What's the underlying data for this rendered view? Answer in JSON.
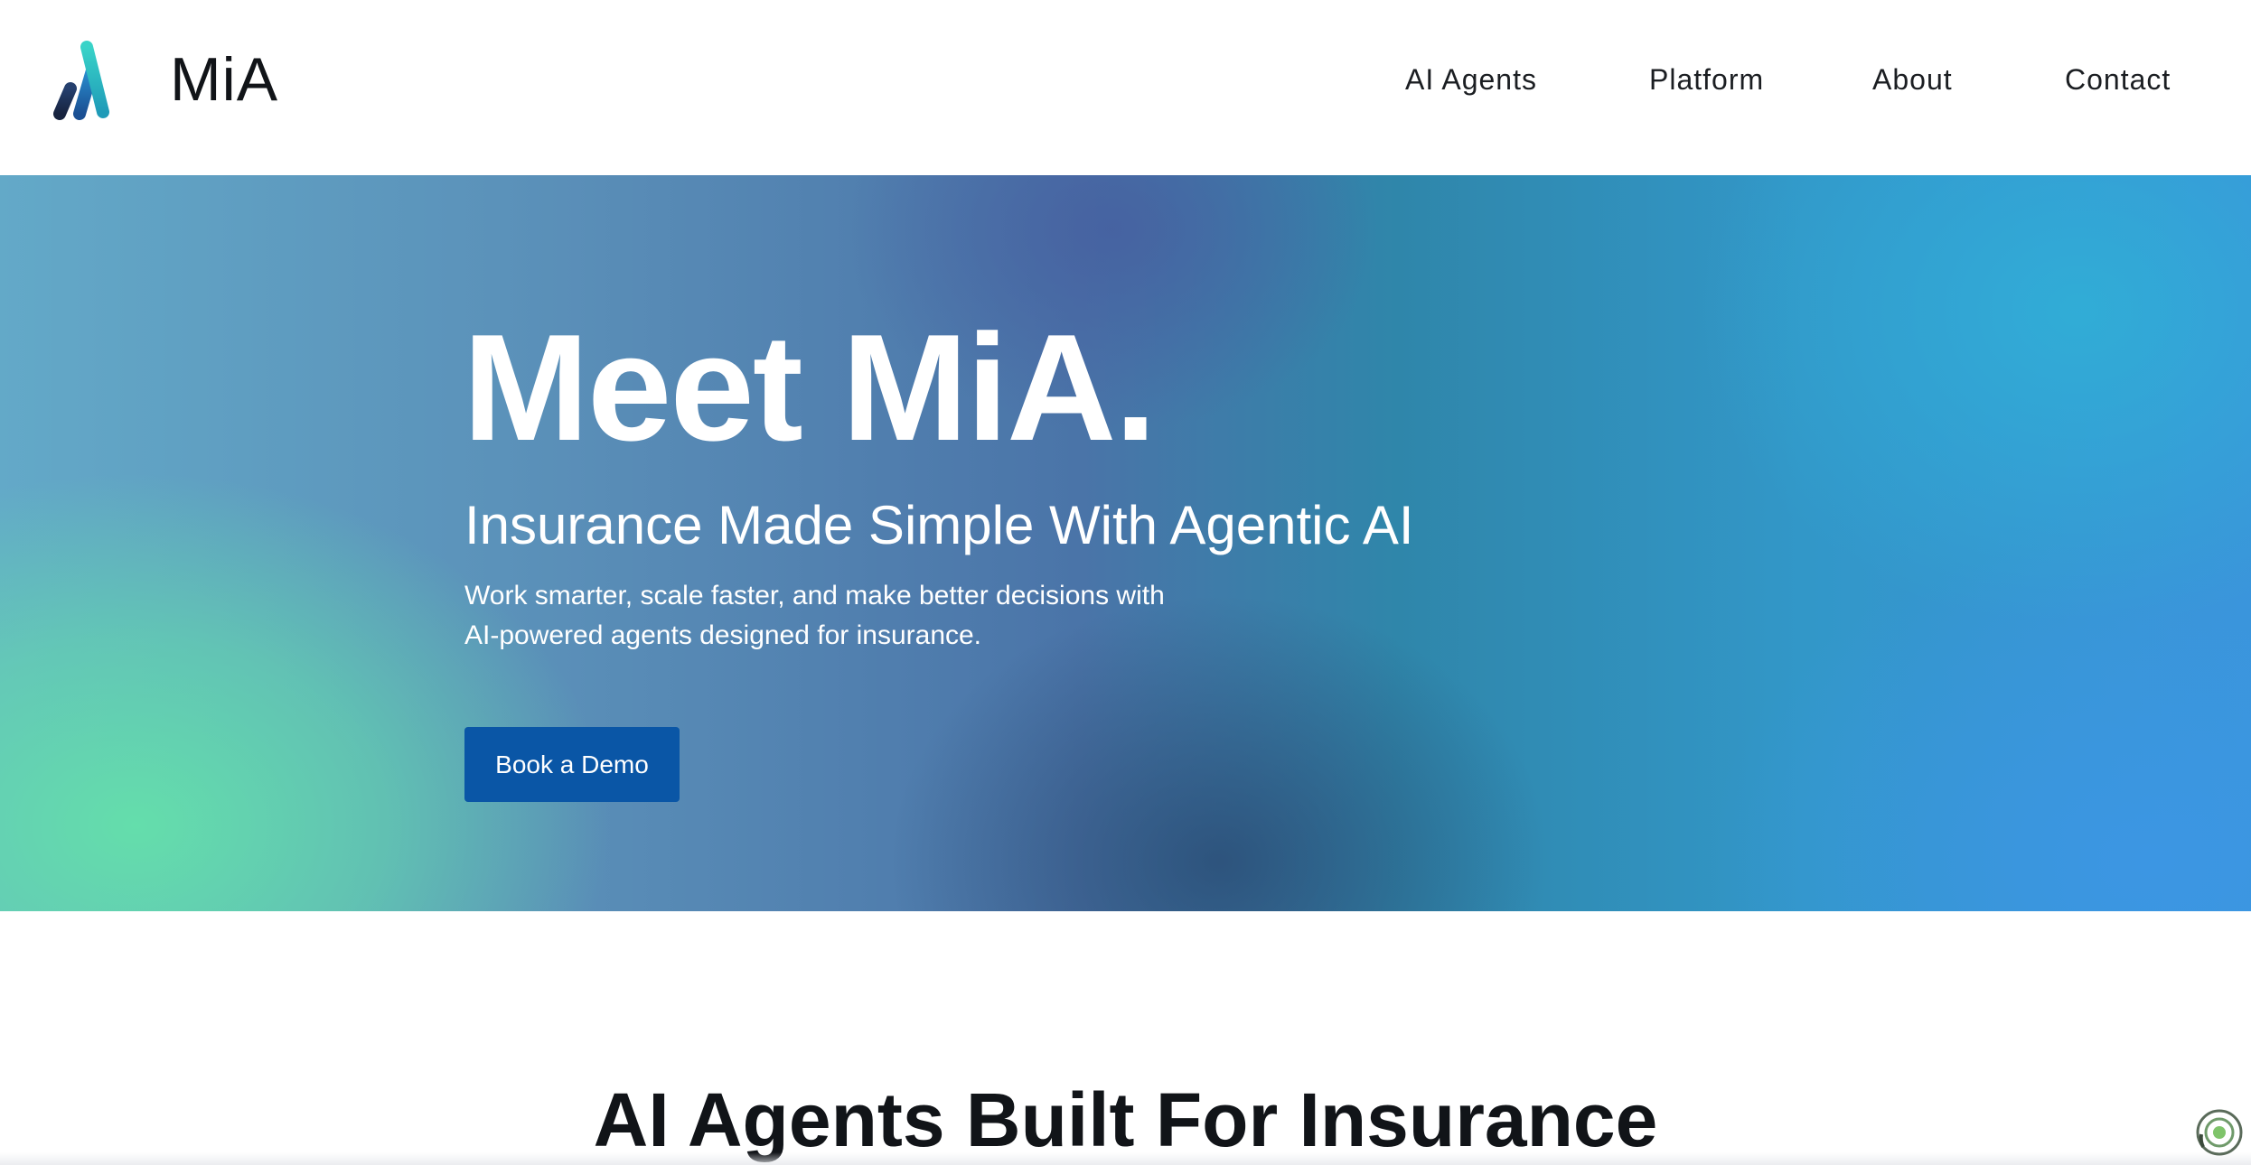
{
  "header": {
    "brand": "MiA",
    "nav": [
      {
        "label": "AI Agents"
      },
      {
        "label": "Platform"
      },
      {
        "label": "About"
      },
      {
        "label": "Contact"
      }
    ]
  },
  "hero": {
    "title": "Meet MiA.",
    "subtitle": "Insurance Made Simple With Agentic AI",
    "description_lines": [
      "Work smarter, scale faster, and make better decisions with",
      "AI-powered agents designed for insurance."
    ],
    "cta_label": "Book a Demo"
  },
  "section": {
    "title": "AI Agents Built For Insurance"
  },
  "colors": {
    "cta_background": "#0a56a6",
    "logo_dark": "#1b2f55",
    "logo_mid": "#1f78c6",
    "logo_light": "#2ec4c4"
  },
  "icons": {
    "logo": "mia-logo-icon",
    "widget": "assistant-widget-icon"
  }
}
